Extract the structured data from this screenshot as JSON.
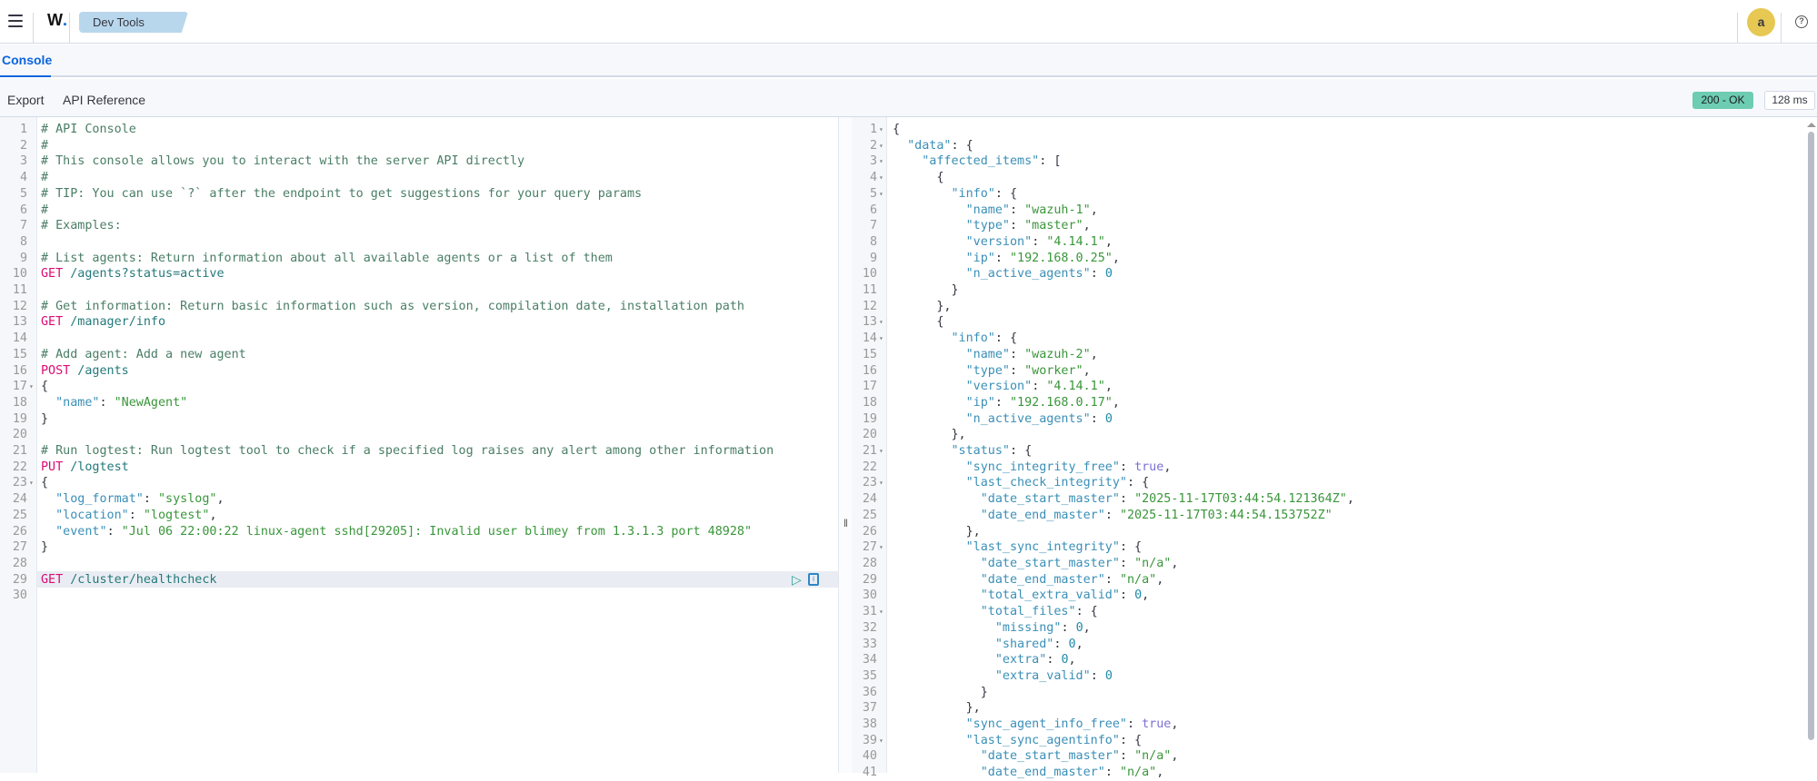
{
  "header": {
    "menu_icon": "hamburger-icon",
    "logo": "W",
    "breadcrumb": "Dev Tools",
    "avatar_initial": "a",
    "help_icon": "question-circle-icon"
  },
  "tabs": [
    {
      "label": "Console",
      "active": true
    }
  ],
  "toolbar": {
    "export_label": "Export",
    "api_reference_label": "API Reference",
    "status": "200 - OK",
    "status_color": "#6dccb1",
    "time": "128 ms"
  },
  "colors": {
    "accent": "#0b64dd",
    "method": "#dd0a73",
    "string": "#39963a",
    "key": "#3a8fb7",
    "bool": "#7c6fd6"
  },
  "request_editor": {
    "active_line": 29,
    "folds": [
      17,
      23
    ],
    "actions": {
      "run_icon": "play-icon",
      "docs_icon": "book-icon"
    },
    "lines": [
      "# API Console",
      "#",
      "# This console allows you to interact with the server API directly",
      "#",
      "# TIP: You can use `?` after the endpoint to get suggestions for your query params",
      "#",
      "# Examples:",
      "",
      "# List agents: Return information about all available agents or a list of them",
      "GET /agents?status=active",
      "",
      "# Get information: Return basic information such as version, compilation date, installation path",
      "GET /manager/info",
      "",
      "# Add agent: Add a new agent",
      "POST /agents",
      "{",
      "  \"name\": \"NewAgent\"",
      "}",
      "",
      "# Run logtest: Run logtest tool to check if a specified log raises any alert among other information",
      "PUT /logtest",
      "{",
      "  \"log_format\": \"syslog\",",
      "  \"location\": \"logtest\",",
      "  \"event\": \"Jul 06 22:00:22 linux-agent sshd[29205]: Invalid user blimey from 1.3.1.3 port 48928\"",
      "}",
      "",
      "GET /cluster/healthcheck",
      ""
    ]
  },
  "response_editor": {
    "folds": [
      1,
      2,
      3,
      4,
      5,
      13,
      14,
      21,
      23,
      27,
      31,
      39
    ],
    "lines": [
      "{",
      "  \"data\": {",
      "    \"affected_items\": [",
      "      {",
      "        \"info\": {",
      "          \"name\": \"wazuh-1\",",
      "          \"type\": \"master\",",
      "          \"version\": \"4.14.1\",",
      "          \"ip\": \"192.168.0.25\",",
      "          \"n_active_agents\": 0",
      "        }",
      "      },",
      "      {",
      "        \"info\": {",
      "          \"name\": \"wazuh-2\",",
      "          \"type\": \"worker\",",
      "          \"version\": \"4.14.1\",",
      "          \"ip\": \"192.168.0.17\",",
      "          \"n_active_agents\": 0",
      "        },",
      "        \"status\": {",
      "          \"sync_integrity_free\": true,",
      "          \"last_check_integrity\": {",
      "            \"date_start_master\": \"2025-11-17T03:44:54.121364Z\",",
      "            \"date_end_master\": \"2025-11-17T03:44:54.153752Z\"",
      "          },",
      "          \"last_sync_integrity\": {",
      "            \"date_start_master\": \"n/a\",",
      "            \"date_end_master\": \"n/a\",",
      "            \"total_extra_valid\": 0,",
      "            \"total_files\": {",
      "              \"missing\": 0,",
      "              \"shared\": 0,",
      "              \"extra\": 0,",
      "              \"extra_valid\": 0",
      "            }",
      "          },",
      "          \"sync_agent_info_free\": true,",
      "          \"last_sync_agentinfo\": {",
      "            \"date_start_master\": \"n/a\",",
      "            \"date_end_master\": \"n/a\","
    ]
  }
}
